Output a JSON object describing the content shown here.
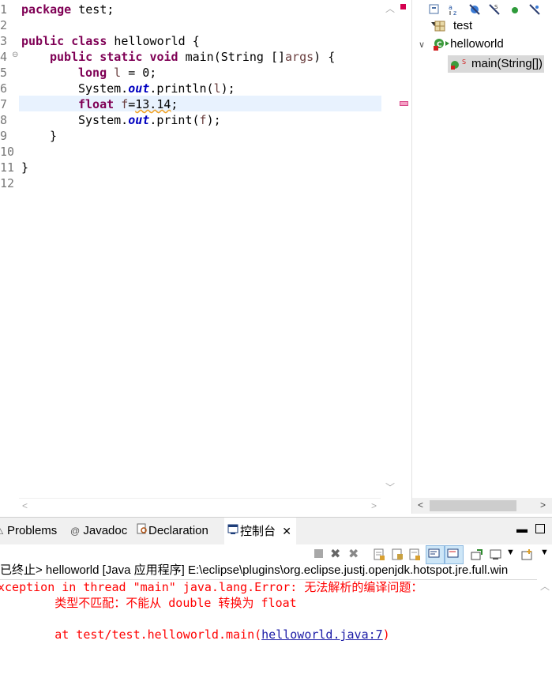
{
  "editor": {
    "line_numbers": [
      "1",
      "2",
      "3",
      "4",
      "5",
      "6",
      "7",
      "8",
      "9",
      "10",
      "11",
      "12"
    ],
    "lines": [
      {
        "kw1": "package",
        "rest": " test;"
      },
      {},
      {
        "kw1": "public",
        "kw2": "class",
        "rest": " helloworld {"
      },
      {
        "kw1": "public",
        "kw2": "static",
        "kw3": "void",
        "rest": " main(String []",
        "var": "args",
        "rest2": ") {"
      },
      {
        "kw1": "long",
        "var": "l",
        "rest": " = 0;"
      },
      {
        "pre": "System.",
        "fld": "out",
        "rest": ".println(",
        "var": "l",
        "rest2": ");"
      },
      {
        "kw1": "float",
        "var": "f",
        "rest": "=",
        "err": "13.14",
        "rest2": ";"
      },
      {
        "pre": "System.",
        "fld": "out",
        "rest": ".print(",
        "var": "f",
        "rest2": ");"
      },
      {
        "rest": "}"
      },
      {},
      {
        "rest": "}"
      },
      {}
    ]
  },
  "outline": {
    "package": "test",
    "class": "helloworld",
    "method": "main(String[])"
  },
  "panel": {
    "tabs": [
      {
        "label": "Problems"
      },
      {
        "label": "Javadoc"
      },
      {
        "label": "Declaration"
      },
      {
        "label": "控制台"
      }
    ],
    "console_header": "已终止> helloworld [Java 应用程序] E:\\eclipse\\plugins\\org.eclipse.justj.openjdk.hotspot.jre.full.win",
    "console_lines": [
      "xception in thread \"main\" java.lang.Error: 无法解析的编译问题：",
      "        类型不匹配：不能从 double 转换为 float",
      "",
      "        at test/test.helloworld.main(",
      "helloworld.java:7",
      ")"
    ]
  },
  "colors": {
    "keyword": "#7f0055",
    "field": "#0000c0",
    "error_text": "#ff0000",
    "current_line": "#e8f2fe"
  }
}
